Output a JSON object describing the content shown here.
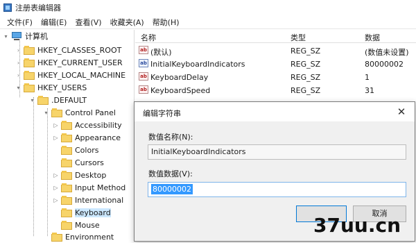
{
  "window": {
    "title": "注册表编辑器"
  },
  "menu": [
    "文件(F)",
    "编辑(E)",
    "查看(V)",
    "收藏夹(A)",
    "帮助(H)"
  ],
  "tree": {
    "root": "计算机",
    "hives": [
      "HKEY_CLASSES_ROOT",
      "HKEY_CURRENT_USER",
      "HKEY_LOCAL_MACHINE",
      "HKEY_USERS"
    ],
    "default_key": ".DEFAULT",
    "control_panel": "Control Panel",
    "children": [
      "Accessibility",
      "Appearance",
      "Colors",
      "Cursors",
      "Desktop",
      "Input Method",
      "International",
      "Keyboard",
      "Mouse"
    ],
    "environment": "Environment",
    "selected": "Keyboard"
  },
  "list": {
    "headers": {
      "name": "名称",
      "type": "类型",
      "data": "数据"
    },
    "rows": [
      {
        "name": "(默认)",
        "type": "REG_SZ",
        "data": "(数值未设置)"
      },
      {
        "name": "InitialKeyboardIndicators",
        "type": "REG_SZ",
        "data": "80000002"
      },
      {
        "name": "KeyboardDelay",
        "type": "REG_SZ",
        "data": "1"
      },
      {
        "name": "KeyboardSpeed",
        "type": "REG_SZ",
        "data": "31"
      }
    ]
  },
  "dialog": {
    "title": "编辑字符串",
    "close_glyph": "✕",
    "name_label": "数值名称(N):",
    "name_value": "InitialKeyboardIndicators",
    "data_label": "数值数据(V):",
    "data_value": "80000002",
    "cancel_label": "取消"
  },
  "watermark": {
    "text": "37uu.cn"
  },
  "colors": {
    "selection": "#3399ff",
    "folder": "#f7d46a",
    "tree_selected": "#cce8ff"
  }
}
